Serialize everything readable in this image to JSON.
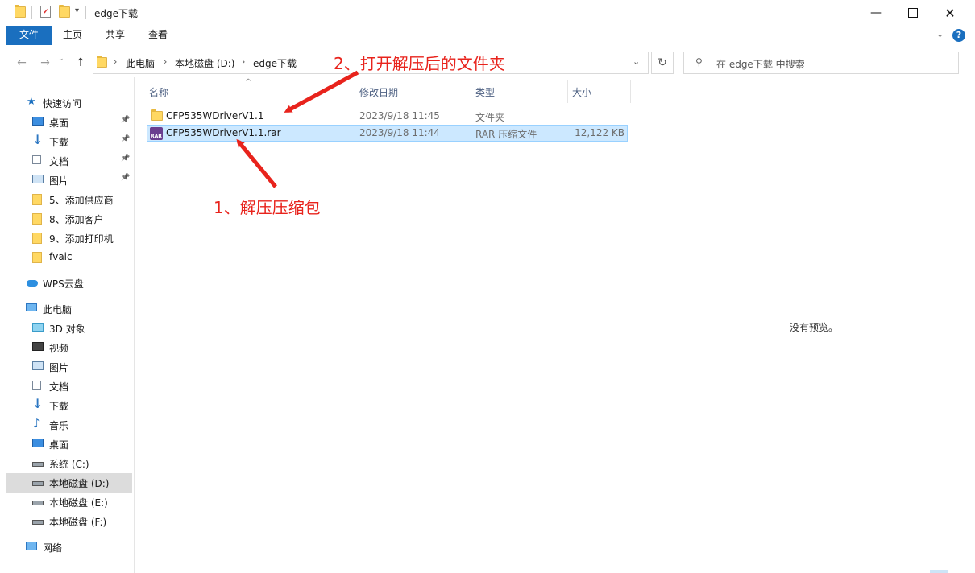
{
  "window": {
    "title": "edge下载",
    "controls": [
      "minimize-icon",
      "maximize-icon",
      "close-icon"
    ]
  },
  "ribbon": {
    "tabs": [
      "文件",
      "主页",
      "共享",
      "查看"
    ]
  },
  "address": {
    "breadcrumbs": [
      "此电脑",
      "本地磁盘 (D:)",
      "edge下载"
    ]
  },
  "search": {
    "placeholder": "在 edge下载 中搜索"
  },
  "nav": {
    "quick_access": "快速访问",
    "quick_items": [
      {
        "label": "桌面",
        "icon": "desktop-icon",
        "pinned": true
      },
      {
        "label": "下载",
        "icon": "download-icon",
        "pinned": true
      },
      {
        "label": "文档",
        "icon": "document-icon",
        "pinned": true
      },
      {
        "label": "图片",
        "icon": "picture-icon",
        "pinned": true
      },
      {
        "label": "5、添加供应商",
        "icon": "folder-icon",
        "pinned": false
      },
      {
        "label": "8、添加客户",
        "icon": "folder-icon",
        "pinned": false
      },
      {
        "label": "9、添加打印机",
        "icon": "folder-icon",
        "pinned": false
      },
      {
        "label": "fvaic",
        "icon": "folder-icon",
        "pinned": false
      }
    ],
    "wps": "WPS云盘",
    "this_pc": "此电脑",
    "pc_items": [
      {
        "label": "3D 对象",
        "icon": "3d-objects-icon"
      },
      {
        "label": "视频",
        "icon": "video-icon"
      },
      {
        "label": "图片",
        "icon": "picture-icon"
      },
      {
        "label": "文档",
        "icon": "document-icon"
      },
      {
        "label": "下载",
        "icon": "download-icon"
      },
      {
        "label": "音乐",
        "icon": "music-icon"
      },
      {
        "label": "桌面",
        "icon": "desktop-icon"
      },
      {
        "label": "系统 (C:)",
        "icon": "drive-icon"
      },
      {
        "label": "本地磁盘 (D:)",
        "icon": "drive-icon",
        "selected": true
      },
      {
        "label": "本地磁盘 (E:)",
        "icon": "drive-icon"
      },
      {
        "label": "本地磁盘 (F:)",
        "icon": "drive-icon"
      }
    ],
    "network": "网络"
  },
  "list": {
    "columns": [
      "名称",
      "修改日期",
      "类型",
      "大小"
    ],
    "rows": [
      {
        "name": "CFP535WDriverV1.1",
        "date": "2023/9/18 11:45",
        "type": "文件夹",
        "size": "",
        "icon": "folder-icon"
      },
      {
        "name": "CFP535WDriverV1.1.rar",
        "date": "2023/9/18 11:44",
        "type": "RAR 压缩文件",
        "size": "12,122 KB",
        "icon": "rar-archive-icon",
        "selected": true
      }
    ]
  },
  "preview": {
    "text": "没有预览。"
  },
  "annotations": {
    "step1": "1、解压压缩包",
    "step2": "2、打开解压后的文件夹",
    "color": "#e8231c"
  },
  "colors": {
    "accent": "#1a6fbf",
    "selection": "#cce8ff"
  }
}
